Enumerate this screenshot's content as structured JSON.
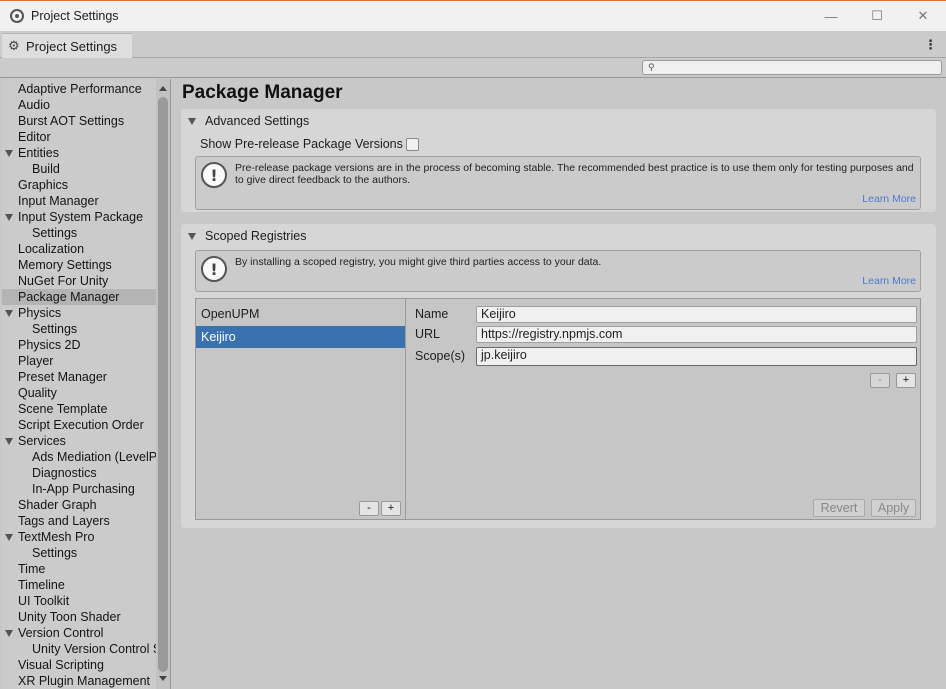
{
  "window": {
    "title": "Project Settings",
    "controls": [
      "minimize",
      "maximize",
      "close"
    ]
  },
  "tab": {
    "label": "Project Settings",
    "icon": "gear-icon"
  },
  "search": {
    "placeholder": "",
    "value": ""
  },
  "sidebar": {
    "items": [
      {
        "label": "Adaptive Performance",
        "indent": 0,
        "expandable": false
      },
      {
        "label": "Audio",
        "indent": 0,
        "expandable": false
      },
      {
        "label": "Burst AOT Settings",
        "indent": 0,
        "expandable": false
      },
      {
        "label": "Editor",
        "indent": 0,
        "expandable": false
      },
      {
        "label": "Entities",
        "indent": 0,
        "expandable": true
      },
      {
        "label": "Build",
        "indent": 1,
        "expandable": false
      },
      {
        "label": "Graphics",
        "indent": 0,
        "expandable": false
      },
      {
        "label": "Input Manager",
        "indent": 0,
        "expandable": false
      },
      {
        "label": "Input System Package",
        "indent": 0,
        "expandable": true
      },
      {
        "label": "Settings",
        "indent": 1,
        "expandable": false
      },
      {
        "label": "Localization",
        "indent": 0,
        "expandable": false
      },
      {
        "label": "Memory Settings",
        "indent": 0,
        "expandable": false
      },
      {
        "label": "NuGet For Unity",
        "indent": 0,
        "expandable": false
      },
      {
        "label": "Package Manager",
        "indent": 0,
        "expandable": false,
        "selected": true
      },
      {
        "label": "Physics",
        "indent": 0,
        "expandable": true
      },
      {
        "label": "Settings",
        "indent": 1,
        "expandable": false
      },
      {
        "label": "Physics 2D",
        "indent": 0,
        "expandable": false
      },
      {
        "label": "Player",
        "indent": 0,
        "expandable": false
      },
      {
        "label": "Preset Manager",
        "indent": 0,
        "expandable": false
      },
      {
        "label": "Quality",
        "indent": 0,
        "expandable": false
      },
      {
        "label": "Scene Template",
        "indent": 0,
        "expandable": false
      },
      {
        "label": "Script Execution Order",
        "indent": 0,
        "expandable": false
      },
      {
        "label": "Services",
        "indent": 0,
        "expandable": true
      },
      {
        "label": "Ads Mediation (LevelP",
        "indent": 1,
        "expandable": false
      },
      {
        "label": "Diagnostics",
        "indent": 1,
        "expandable": false
      },
      {
        "label": "In-App Purchasing",
        "indent": 1,
        "expandable": false
      },
      {
        "label": "Shader Graph",
        "indent": 0,
        "expandable": false
      },
      {
        "label": "Tags and Layers",
        "indent": 0,
        "expandable": false
      },
      {
        "label": "TextMesh Pro",
        "indent": 0,
        "expandable": true
      },
      {
        "label": "Settings",
        "indent": 1,
        "expandable": false
      },
      {
        "label": "Time",
        "indent": 0,
        "expandable": false
      },
      {
        "label": "Timeline",
        "indent": 0,
        "expandable": false
      },
      {
        "label": "UI Toolkit",
        "indent": 0,
        "expandable": false
      },
      {
        "label": "Unity Toon Shader",
        "indent": 0,
        "expandable": false
      },
      {
        "label": "Version Control",
        "indent": 0,
        "expandable": true
      },
      {
        "label": "Unity Version Control S",
        "indent": 1,
        "expandable": false
      },
      {
        "label": "Visual Scripting",
        "indent": 0,
        "expandable": false
      },
      {
        "label": "XR Plugin Management",
        "indent": 0,
        "expandable": false
      }
    ]
  },
  "main": {
    "title": "Package Manager",
    "advanced": {
      "header": "Advanced Settings",
      "prerelease_label": "Show Pre-release Package Versions",
      "prerelease_checked": false,
      "help_text": "Pre-release package versions are in the process of becoming stable. The recommended best practice is to use them only for testing purposes and to give direct feedback to the authors.",
      "learn_more": "Learn More"
    },
    "scoped": {
      "header": "Scoped Registries",
      "help_text": "By installing a scoped registry, you might give third parties access to your data.",
      "learn_more": "Learn More",
      "registries": [
        {
          "name": "OpenUPM",
          "selected": false
        },
        {
          "name": "Keijiro",
          "selected": true
        }
      ],
      "list_remove": "-",
      "list_add": "+",
      "name_label": "Name",
      "name_value": "Keijiro",
      "url_label": "URL",
      "url_value": "https://registry.npmjs.com",
      "scope_label": "Scope(s)",
      "scope_value": "jp.keijiro",
      "scope_remove": "-",
      "scope_add": "+",
      "revert": "Revert",
      "apply": "Apply"
    }
  }
}
